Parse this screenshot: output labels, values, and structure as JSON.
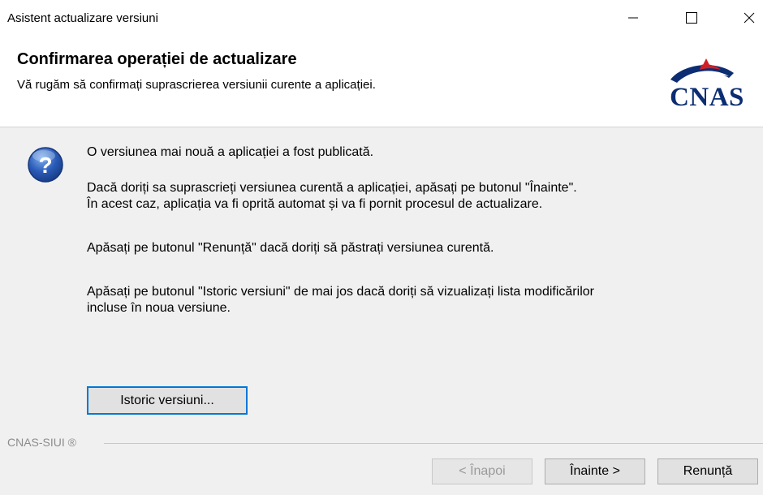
{
  "window": {
    "title": "Asistent actualizare versiuni",
    "controls": {
      "minimize": "minimize-icon",
      "maximize": "maximize-icon",
      "close": "close-icon"
    }
  },
  "header": {
    "title": "Confirmarea operației de actualizare",
    "subtitle": "Vă rugăm să confirmați suprascrierea versiunii curente a aplicației.",
    "logo_text": "CNAS"
  },
  "body": {
    "icon": "question-icon",
    "line1": "O versiunea mai nouă a aplicației a fost publicată.",
    "line2a": "Dacă doriți sa suprascrieți versiunea curentă a aplicației, apăsați pe butonul \"Înainte\".",
    "line2b": "În acest caz, aplicația va fi oprită automat și va fi pornit procesul de actualizare.",
    "line3": "Apăsați pe butonul \"Renunță\" dacă doriți să păstrați versiunea curentă.",
    "line4a": "Apăsați pe butonul \"Istoric versiuni\" de mai jos dacă doriți să vizualizați lista modificărilor",
    "line4b": "incluse în noua versiune.",
    "history_button": "Istoric versiuni..."
  },
  "footer": {
    "label": "CNAS-SIUI ®",
    "back_button": "< Înapoi",
    "next_button": "Înainte >",
    "cancel_button": "Renunță"
  },
  "colors": {
    "logo_blue": "#0c2d72",
    "logo_red": "#d11f26",
    "focus_border": "#0078d7",
    "question_icon": "#2a5bb8"
  }
}
